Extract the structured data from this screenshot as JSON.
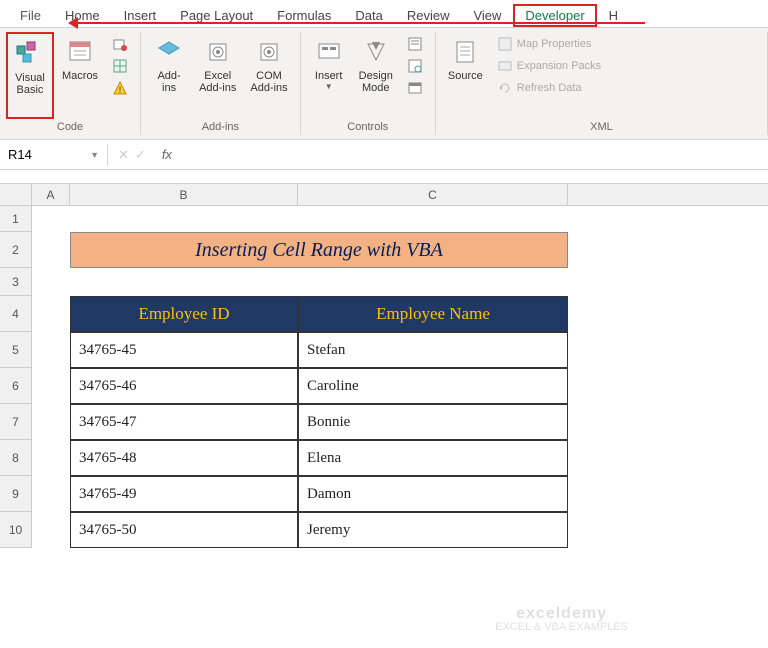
{
  "tabs": {
    "file": "File",
    "home": "Home",
    "insert": "Insert",
    "pageLayout": "Page Layout",
    "formulas": "Formulas",
    "data": "Data",
    "review": "Review",
    "view": "View",
    "developer": "Developer",
    "helpInitial": "H"
  },
  "ribbon": {
    "code": {
      "label": "Code",
      "visualBasic": "Visual\nBasic",
      "macros": "Macros"
    },
    "addins": {
      "label": "Add-ins",
      "addins": "Add-\nins",
      "excelAddins": "Excel\nAdd-ins",
      "comAddins": "COM\nAdd-ins"
    },
    "controls": {
      "label": "Controls",
      "insert": "Insert",
      "designMode": "Design\nMode"
    },
    "xml": {
      "label": "XML",
      "source": "Source",
      "mapProps": "Map Properties",
      "expansion": "Expansion Packs",
      "refresh": "Refresh Data"
    }
  },
  "namebox": "R14",
  "fx": "fx",
  "columns": {
    "A": "A",
    "B": "B",
    "C": "C"
  },
  "rows": [
    "1",
    "2",
    "3",
    "4",
    "5",
    "6",
    "7",
    "8",
    "9",
    "10"
  ],
  "sheet": {
    "title": "Inserting Cell Range with VBA",
    "headers": {
      "id": "Employee ID",
      "name": "Employee Name"
    },
    "data": [
      {
        "id": "34765-45",
        "name": "Stefan"
      },
      {
        "id": "34765-46",
        "name": "Caroline"
      },
      {
        "id": "34765-47",
        "name": "Bonnie"
      },
      {
        "id": "34765-48",
        "name": "Elena"
      },
      {
        "id": "34765-49",
        "name": "Damon"
      },
      {
        "id": "34765-50",
        "name": "Jeremy"
      }
    ]
  },
  "watermark": {
    "brand": "exceldemy",
    "tag": "EXCEL & VBA EXAMPLES"
  }
}
